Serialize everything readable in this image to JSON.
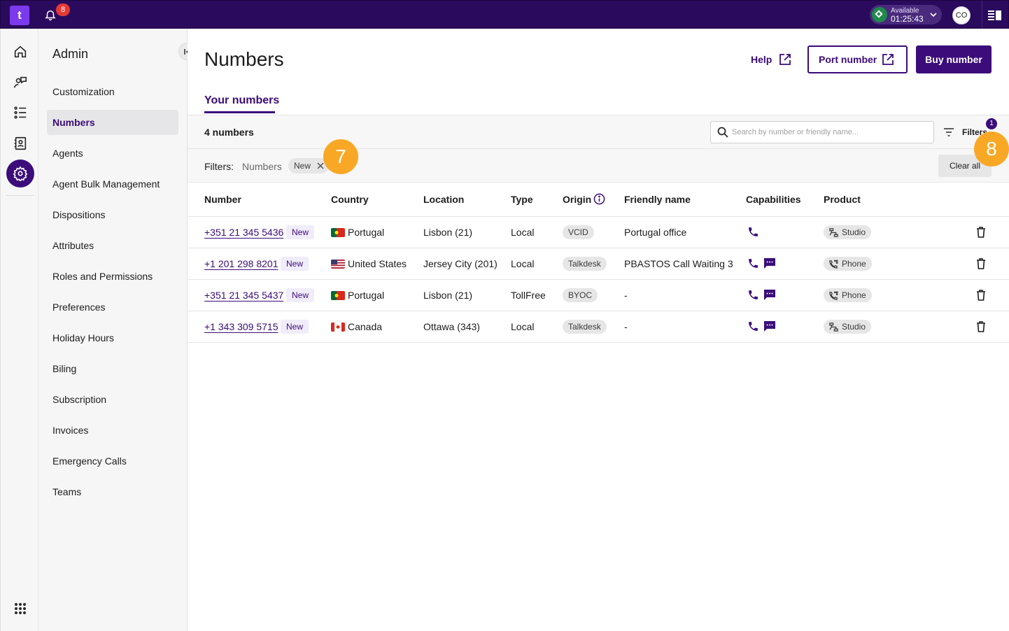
{
  "topbar": {
    "logo": "t",
    "notifications_count": "8",
    "status_label": "Available",
    "status_time": "01:25:43",
    "avatar_initials": "CO",
    "brand_color": "#2a0a5c"
  },
  "rail": {
    "icons": [
      "home-icon",
      "agent-speech-icon",
      "list-icon",
      "contacts-book-icon",
      "gear-icon"
    ],
    "apps_icon": "apps-grid-icon"
  },
  "sidebar": {
    "title": "Admin",
    "items": [
      {
        "label": "Customization",
        "active": false
      },
      {
        "label": "Numbers",
        "active": true
      },
      {
        "label": "Agents",
        "active": false
      },
      {
        "label": "Agent Bulk Management",
        "active": false
      },
      {
        "label": "Dispositions",
        "active": false
      },
      {
        "label": "Attributes",
        "active": false
      },
      {
        "label": "Roles and Permissions",
        "active": false
      },
      {
        "label": "Preferences",
        "active": false
      },
      {
        "label": "Holiday Hours",
        "active": false
      },
      {
        "label": "Biling",
        "active": false
      },
      {
        "label": "Subscription",
        "active": false
      },
      {
        "label": "Invoices",
        "active": false
      },
      {
        "label": "Emergency Calls",
        "active": false
      },
      {
        "label": "Teams",
        "active": false
      }
    ]
  },
  "header": {
    "title": "Numbers",
    "help_label": "Help",
    "port_label": "Port number",
    "buy_label": "Buy number",
    "accent_color": "#3b0c7a"
  },
  "tabs": [
    {
      "label": "Your numbers",
      "active": true
    }
  ],
  "toolbar": {
    "count": "4 numbers",
    "search_placeholder": "Search by number or friendly name...",
    "filters_label": "Filters",
    "filters_count": "1"
  },
  "filters": {
    "label": "Filters:",
    "field": "Numbers",
    "chip": "New",
    "clear_label": "Clear all"
  },
  "markers": [
    "7",
    "8"
  ],
  "table": {
    "columns": [
      "Number",
      "Country",
      "Location",
      "Type",
      "Origin",
      "Friendly name",
      "Capabilities",
      "Product"
    ],
    "rows": [
      {
        "number": "+351 21 345 5436",
        "badge": "New",
        "country": "Portugal",
        "flag": "pt",
        "location": "Lisbon (21)",
        "type": "Local",
        "origin": "VCID",
        "friendly": "Portugal office",
        "capabilities": [
          "phone-icon"
        ],
        "product": "Studio",
        "product_icon": "studio-flow-icon"
      },
      {
        "number": "+1 201 298 8201",
        "badge": "New",
        "country": "United States",
        "flag": "us",
        "location": "Jersey City (201)",
        "type": "Local",
        "origin": "Talkdesk",
        "friendly": "PBASTOS Call Waiting 3",
        "capabilities": [
          "phone-icon",
          "message-icon"
        ],
        "product": "Phone",
        "product_icon": "phone-dial-icon"
      },
      {
        "number": "+351 21 345 5437",
        "badge": "New",
        "country": "Portugal",
        "flag": "pt",
        "location": "Lisbon (21)",
        "type": "TollFree",
        "origin": "BYOC",
        "friendly": "-",
        "capabilities": [
          "phone-icon",
          "message-icon"
        ],
        "product": "Phone",
        "product_icon": "phone-dial-icon"
      },
      {
        "number": "+1 343 309 5715",
        "badge": "New",
        "country": "Canada",
        "flag": "ca",
        "location": "Ottawa (343)",
        "type": "Local",
        "origin": "Talkdesk",
        "friendly": "-",
        "capabilities": [
          "phone-icon",
          "message-icon"
        ],
        "product": "Studio",
        "product_icon": "studio-flow-icon"
      }
    ]
  }
}
